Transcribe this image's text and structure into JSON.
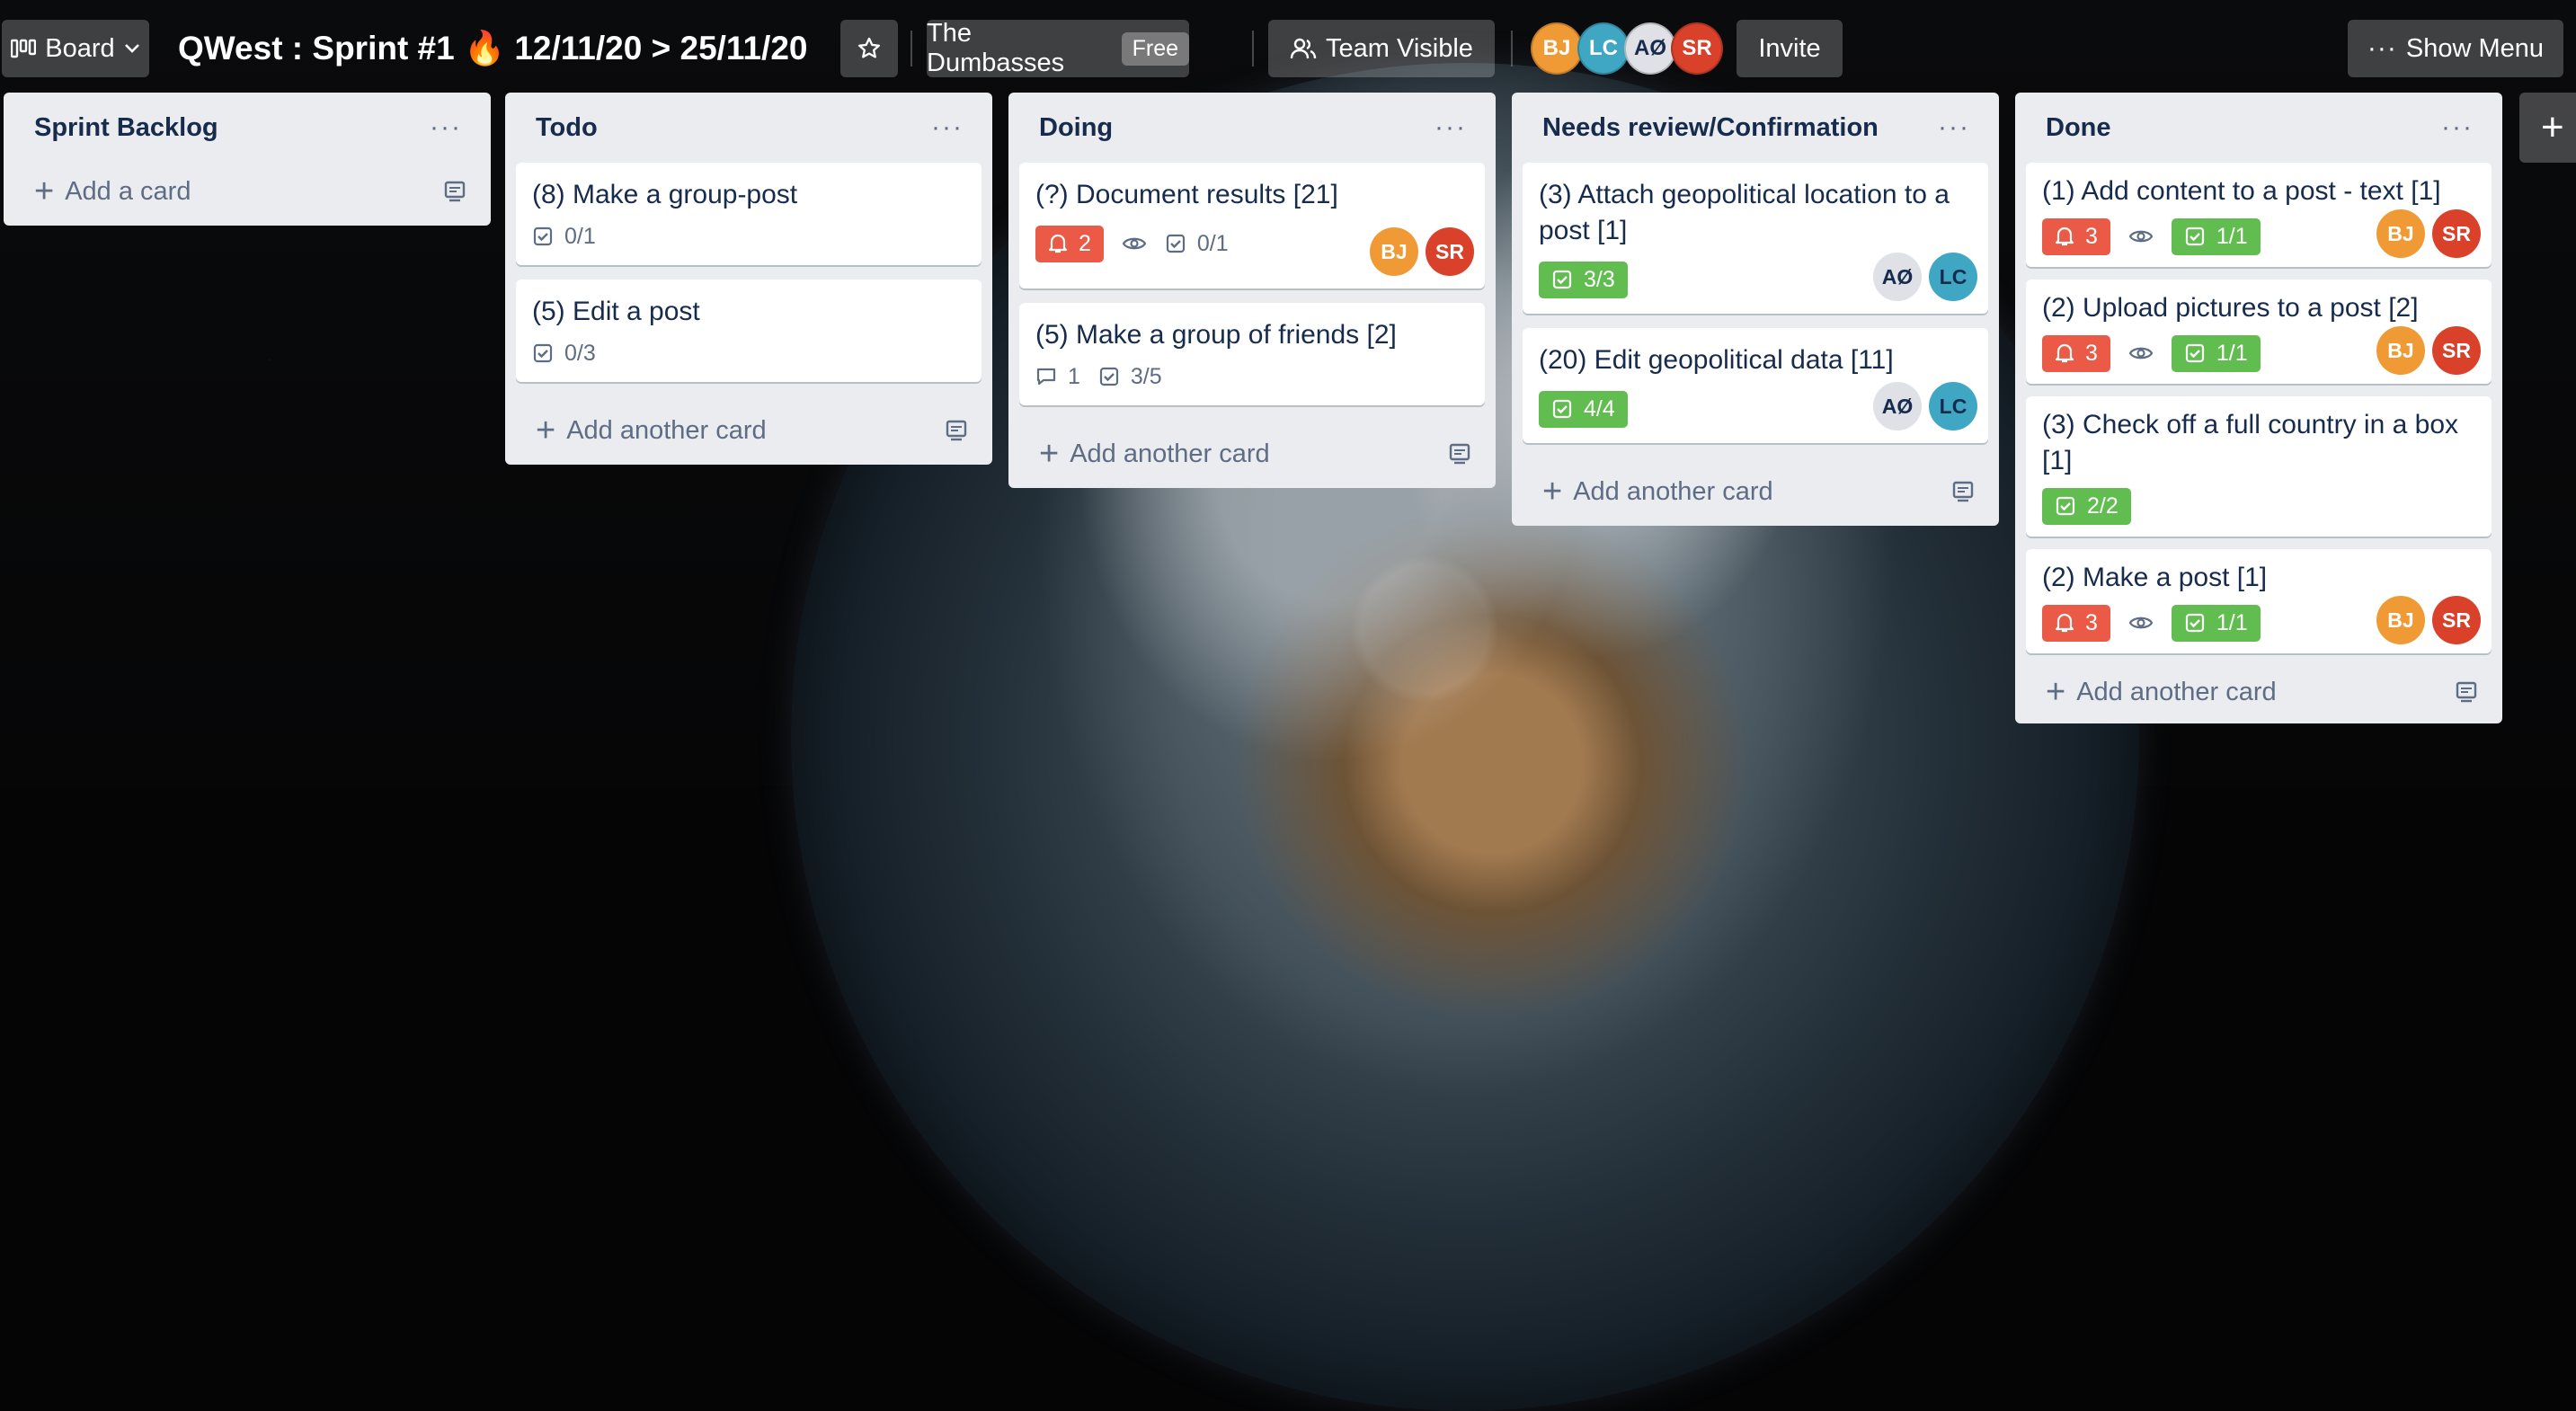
{
  "header": {
    "board_label": "Board",
    "title": "QWest : Sprint #1 🔥 12/11/20 > 25/11/20",
    "team_name": "The Dumbasses",
    "team_plan": "Free",
    "visibility_label": "Team Visible",
    "members": [
      {
        "initials": "BJ",
        "color": "#f09a35"
      },
      {
        "initials": "LC",
        "color": "#3fa6c4"
      },
      {
        "initials": "AØ",
        "color": "#dfe1e6"
      },
      {
        "initials": "SR",
        "color": "#d9412b"
      }
    ],
    "invite_label": "Invite",
    "show_menu_label": "Show Menu"
  },
  "lists": [
    {
      "title": "Sprint Backlog",
      "add_label": "Add a card",
      "cards": []
    },
    {
      "title": "Todo",
      "add_label": "Add another card",
      "cards": [
        {
          "title": "(8) Make a group-post",
          "checklist": "0/1"
        },
        {
          "title": "(5) Edit a post",
          "checklist": "0/3"
        }
      ]
    },
    {
      "title": "Doing",
      "add_label": "Add another card",
      "cards": [
        {
          "title": "(?) Document results [21]",
          "due": "2",
          "checklist": "0/1",
          "members": [
            "BJ",
            "SR"
          ]
        },
        {
          "title": "(5) Make a group of friends [2]",
          "comments": "1",
          "checklist": "3/5"
        }
      ]
    },
    {
      "title": "Needs review/Confirmation",
      "add_label": "Add another card",
      "cards": [
        {
          "title": "(3) Attach geopolitical location to a post [1]",
          "checklist": "3/3",
          "members": [
            "AØ",
            "LC"
          ]
        },
        {
          "title": "(20) Edit geopolitical data [11]",
          "checklist": "4/4",
          "members": [
            "AØ",
            "LC"
          ]
        }
      ]
    },
    {
      "title": "Done",
      "add_label": "Add another card",
      "cards": [
        {
          "title": "(1) Add content to a post - text [1]",
          "due": "3",
          "checklist": "1/1",
          "members": [
            "BJ",
            "SR"
          ]
        },
        {
          "title": "(2) Upload pictures to a post [2]",
          "due": "3",
          "checklist": "1/1",
          "members": [
            "BJ",
            "SR"
          ]
        },
        {
          "title": "(3) Check off a full country in a box [1]",
          "checklist": "2/2"
        },
        {
          "title": "(2) Make a post [1]",
          "due": "3",
          "checklist": "1/1",
          "members": [
            "BJ",
            "SR"
          ]
        }
      ]
    }
  ],
  "colors": {
    "due_red": "#eb5a46",
    "complete_green": "#61bd4f",
    "list_bg": "#ebecf0"
  }
}
